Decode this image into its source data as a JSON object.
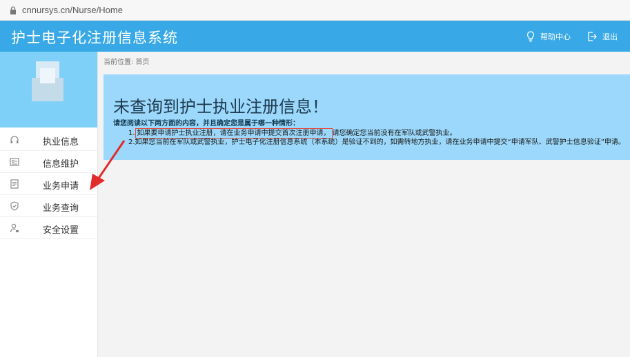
{
  "browser": {
    "url": "cnnursys.cn/Nurse/Home"
  },
  "header": {
    "title": "护士电子化注册信息系统",
    "help_label": "帮助中心",
    "logout_label": "退出"
  },
  "sidebar": {
    "items": [
      {
        "label": "执业信息",
        "icon": "headset-icon"
      },
      {
        "label": "信息维护",
        "icon": "id-card-icon"
      },
      {
        "label": "业务申请",
        "icon": "document-icon"
      },
      {
        "label": "业务查询",
        "icon": "shield-icon"
      },
      {
        "label": "安全设置",
        "icon": "user-lock-icon"
      }
    ]
  },
  "main": {
    "breadcrumb": "当前位置: 首页",
    "notice": {
      "title": "未查询到护士执业注册信息！",
      "lead": "请您阅读以下两方面的内容，并且确定您是属于哪一种情形：",
      "item1_prefix": "1.",
      "item1_highlight": "如果要申请护士执业注册，请在业务申请中提交首次注册申请，",
      "item1_suffix": "请您确定您当前没有在军队或武警执业。",
      "item2": "2.如果您当前在军队或武警执业，护士电子化注册信息系统（本系统）是验证不到的，如需转地方执业，请在业务申请中提交“申请军队、武警护士信息验证”申请。"
    }
  },
  "colors": {
    "header": "#38a9e6",
    "notice": "#9bd8fb",
    "avatar_bg": "#7fd0f8",
    "highlight": "#e24a3b"
  }
}
